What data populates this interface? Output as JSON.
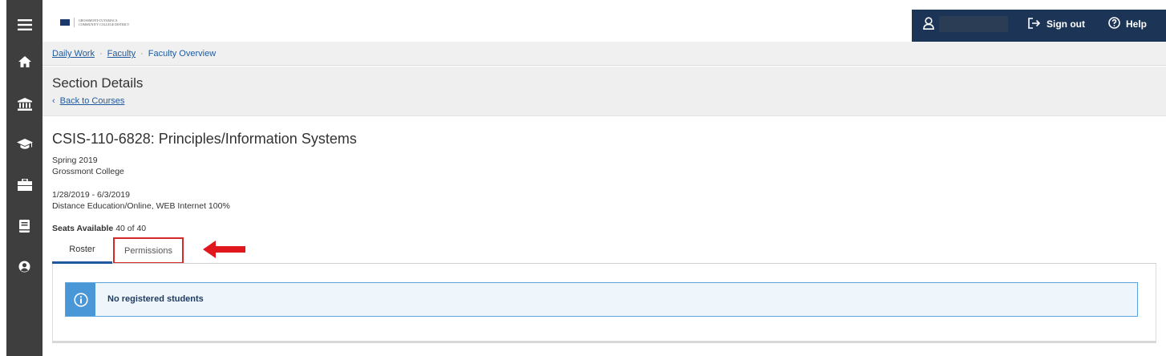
{
  "nav": {
    "items": [
      "menu-icon",
      "home-icon",
      "bank-icon",
      "graduation-cap-icon",
      "briefcase-icon",
      "book-icon",
      "user-circle-icon"
    ]
  },
  "header": {
    "logo_text": "GROSSMONT-CUYAMACA",
    "logo_sub": "COMMUNITY COLLEGE DISTRICT",
    "sign_out": "Sign out",
    "help": "Help"
  },
  "breadcrumb": {
    "daily_work": "Daily Work",
    "faculty": "Faculty",
    "current": "Faculty Overview"
  },
  "page": {
    "title": "Section Details",
    "back_link": "Back to Courses"
  },
  "course": {
    "title": "CSIS-110-6828: Principles/Information Systems",
    "term": "Spring 2019",
    "college": "Grossmont College",
    "dates": "1/28/2019 - 6/3/2019",
    "method": "Distance Education/Online, WEB Internet 100%",
    "seats_label": "Seats Available",
    "seats_value": "40 of 40"
  },
  "tabs": {
    "roster": "Roster",
    "permissions": "Permissions"
  },
  "roster": {
    "message": "No registered students"
  },
  "colors": {
    "nav_bg": "#3e3e3e",
    "user_bar_bg": "#1c3456",
    "link": "#1f5a9e",
    "highlight": "#d62a2a",
    "info_blue": "#4a97d8"
  }
}
